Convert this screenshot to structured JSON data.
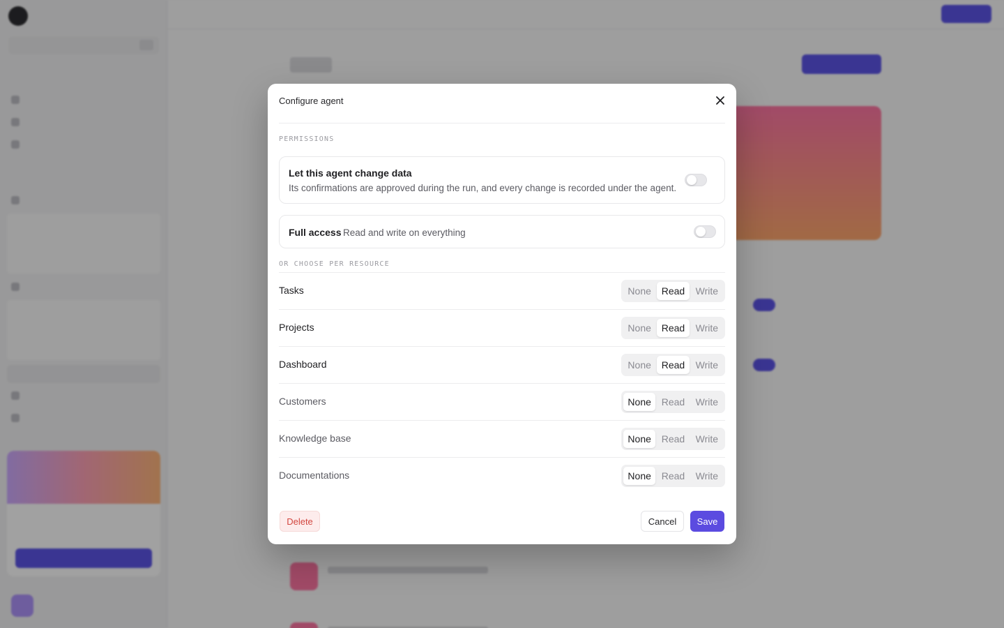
{
  "modal": {
    "title": "Configure agent",
    "permissions_label": "PERMISSIONS",
    "change_data": {
      "title": "Let this agent change data",
      "description": "Its confirmations are approved during the run, and every change is recorded under the agent.",
      "enabled": false
    },
    "full_access": {
      "title": "Full access",
      "description": "Read and write on everything",
      "enabled": false
    },
    "per_resource_label": "OR CHOOSE PER RESOURCE",
    "options": [
      "None",
      "Read",
      "Write"
    ],
    "resources": [
      {
        "name": "Tasks",
        "value": "Read"
      },
      {
        "name": "Projects",
        "value": "Read"
      },
      {
        "name": "Dashboard",
        "value": "Read"
      },
      {
        "name": "Customers",
        "value": "None"
      },
      {
        "name": "Knowledge base",
        "value": "None"
      },
      {
        "name": "Documentations",
        "value": "None"
      }
    ],
    "buttons": {
      "delete": "Delete",
      "cancel": "Cancel",
      "save": "Save"
    }
  },
  "colors": {
    "accent": "#5b4be0",
    "danger": "#d2463f",
    "overlay": "rgba(30,30,30,0.42)"
  },
  "icons": {
    "close": "close-icon"
  }
}
